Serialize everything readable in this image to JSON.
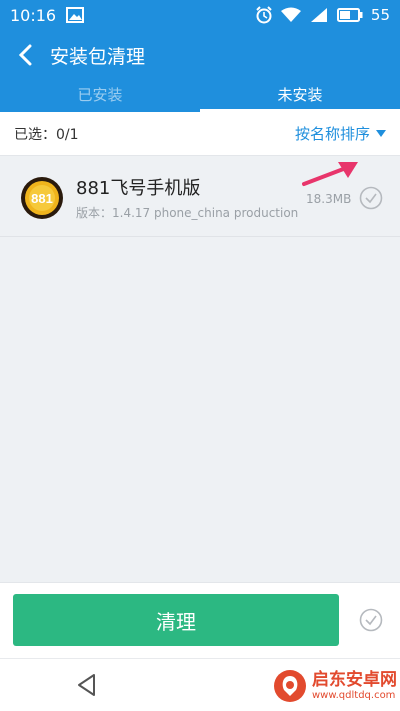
{
  "status_bar": {
    "time": "10:16",
    "battery": "55"
  },
  "app_bar": {
    "title": "安装包清理"
  },
  "tabs": [
    {
      "label": "已安装",
      "active": false
    },
    {
      "label": "未安装",
      "active": true
    }
  ],
  "filter": {
    "selected_label": "已选：0/1",
    "sort_label": "按名称排序"
  },
  "list": [
    {
      "icon_text": "881",
      "name": "881飞号手机版",
      "version": "版本：1.4.17 phone_china production",
      "size": "18.3MB"
    }
  ],
  "actions": {
    "clean_label": "清理"
  },
  "watermark": {
    "main": "启东安卓网",
    "sub": "www.qdltdq.com"
  },
  "colors": {
    "primary": "#1f8fdd",
    "button_green": "#2cb882",
    "arrow_pink": "#e8356b",
    "watermark_red": "#e24a2e"
  }
}
